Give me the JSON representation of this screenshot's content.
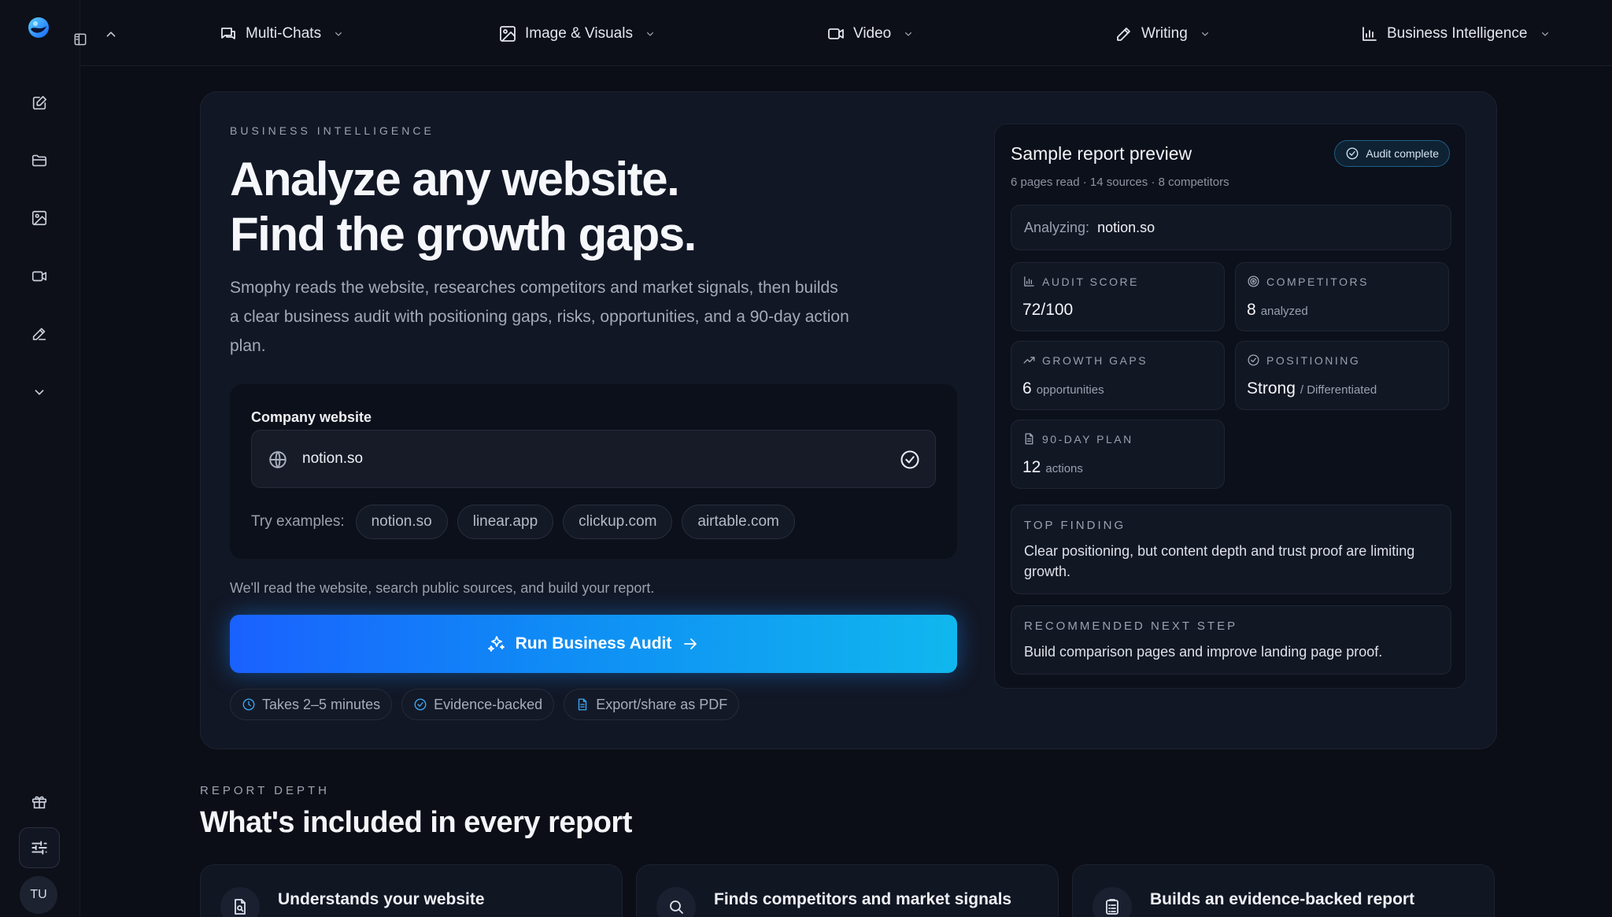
{
  "nav": {
    "items": [
      {
        "label": "Multi-Chats",
        "icon": "chats-icon"
      },
      {
        "label": "Image & Visuals",
        "icon": "image-icon"
      },
      {
        "label": "Video",
        "icon": "video-icon"
      },
      {
        "label": "Writing",
        "icon": "pen-icon"
      },
      {
        "label": "Business Intelligence",
        "icon": "bar-chart-icon"
      }
    ]
  },
  "sidebar": {
    "icons": [
      "new-chat-icon",
      "folder-icon",
      "image-icon",
      "video-icon",
      "pen-icon",
      "chevron-down-icon",
      "gift-icon",
      "sliders-icon"
    ],
    "avatar": "TU"
  },
  "hero": {
    "eyebrow": "BUSINESS INTELLIGENCE",
    "title_line1": "Analyze any website.",
    "title_line2": "Find the growth gaps.",
    "description": "Smophy reads the website, researches competitors and market signals, then builds a clear business audit with positioning gaps, risks, opportunities, and a 90-day action plan.",
    "input": {
      "label": "Company website",
      "value": "notion.so",
      "examples_label": "Try examples:",
      "examples": [
        "notion.so",
        "linear.app",
        "clickup.com",
        "airtable.com"
      ]
    },
    "hint": "We'll read the website, search public sources, and build your report.",
    "cta": "Run Business Audit",
    "features": [
      "Takes 2–5 minutes",
      "Evidence-backed",
      "Export/share as PDF"
    ]
  },
  "preview": {
    "title": "Sample report preview",
    "badge": "Audit complete",
    "subtitle": "6 pages read · 14 sources · 8 competitors",
    "analyzing_label": "Analyzing:",
    "analyzing_value": "notion.so",
    "stats": {
      "audit_score": {
        "label": "AUDIT SCORE",
        "value": "72/100",
        "suffix": ""
      },
      "competitors": {
        "label": "COMPETITORS",
        "value": "8",
        "suffix": "analyzed"
      },
      "growth_gaps": {
        "label": "GROWTH GAPS",
        "value": "6",
        "suffix": "opportunities"
      },
      "positioning": {
        "label": "POSITIONING",
        "value": "Strong",
        "suffix": "/ Differentiated"
      },
      "plan": {
        "label": "90-DAY PLAN",
        "value": "12",
        "suffix": "actions"
      }
    },
    "top_finding": {
      "label": "TOP FINDING",
      "text": "Clear positioning, but content depth and trust proof are limiting growth."
    },
    "next_step": {
      "label": "RECOMMENDED NEXT STEP",
      "text": "Build comparison pages and improve landing page proof."
    }
  },
  "report_depth": {
    "eyebrow": "REPORT DEPTH",
    "title": "What's included in every report",
    "cards": [
      {
        "title": "Understands your website",
        "icon": "page-search-icon"
      },
      {
        "title": "Finds competitors and market signals",
        "icon": "search-icon"
      },
      {
        "title": "Builds an evidence-backed report",
        "icon": "clipboard-icon"
      }
    ]
  },
  "colors": {
    "background": "#0b0e16",
    "card": "#121725",
    "accent": "#1a8cf5"
  }
}
